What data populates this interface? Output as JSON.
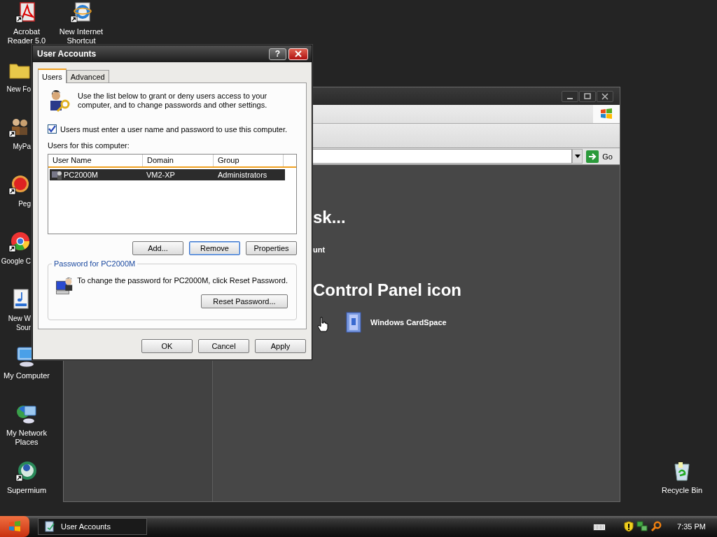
{
  "desktop": {
    "left_column": [
      {
        "label": "Acrobat Reader 5.0",
        "kind": "pdf",
        "shortcut": true
      },
      {
        "label": "New Fo",
        "kind": "folder",
        "shortcut": false
      },
      {
        "label": "MyPa",
        "kind": "people",
        "shortcut": true
      },
      {
        "label": "Peg",
        "kind": "ball",
        "shortcut": true
      },
      {
        "label": "Google C",
        "kind": "chrome",
        "shortcut": true
      },
      {
        "label": "New W\nSour",
        "kind": "audio",
        "shortcut": false
      },
      {
        "label": "My Computer",
        "kind": "computer",
        "shortcut": false
      },
      {
        "label": "My Network Places",
        "kind": "network",
        "shortcut": false
      },
      {
        "label": "Supermium",
        "kind": "supermium",
        "shortcut": true
      }
    ],
    "second_column": [
      {
        "label": "New Internet Shortcut",
        "kind": "browser",
        "shortcut": true
      }
    ],
    "right_column": [
      {
        "label": "Recycle Bin",
        "kind": "recycle",
        "shortcut": false
      }
    ]
  },
  "background_window": {
    "go_button": "Go",
    "heading": "sk...",
    "link": "unt",
    "section_heading": "Control Panel icon",
    "items": [
      {
        "label": "Windows CardSpace"
      }
    ]
  },
  "dialog": {
    "title": "User Accounts",
    "help_button": "?",
    "tabs": [
      {
        "label": "Users",
        "selected": true
      },
      {
        "label": "Advanced",
        "selected": false
      }
    ],
    "intro": "Use the list below to grant or deny users access to your computer, and to change passwords and other settings.",
    "require_login": {
      "label": "Users must enter a user name and password to use this computer.",
      "checked": true
    },
    "list_label": "Users for this computer:",
    "columns": [
      "User Name",
      "Domain",
      "Group"
    ],
    "rows": [
      {
        "user_name": "PC2000M",
        "domain": "VM2-XP",
        "group": "Administrators",
        "selected": true
      }
    ],
    "list_buttons": [
      {
        "label": "Add...",
        "focused": false
      },
      {
        "label": "Remove",
        "focused": true
      },
      {
        "label": "Properties",
        "focused": false
      }
    ],
    "password_group": {
      "title": "Password for PC2000M",
      "text": "To change the password for PC2000M, click Reset Password.",
      "button": "Reset Password..."
    },
    "footer_buttons": [
      "OK",
      "Cancel",
      "Apply"
    ]
  },
  "taskbar": {
    "tasks": [
      {
        "label": "User Accounts",
        "selected": false
      }
    ],
    "clock": "7:35 PM"
  }
}
